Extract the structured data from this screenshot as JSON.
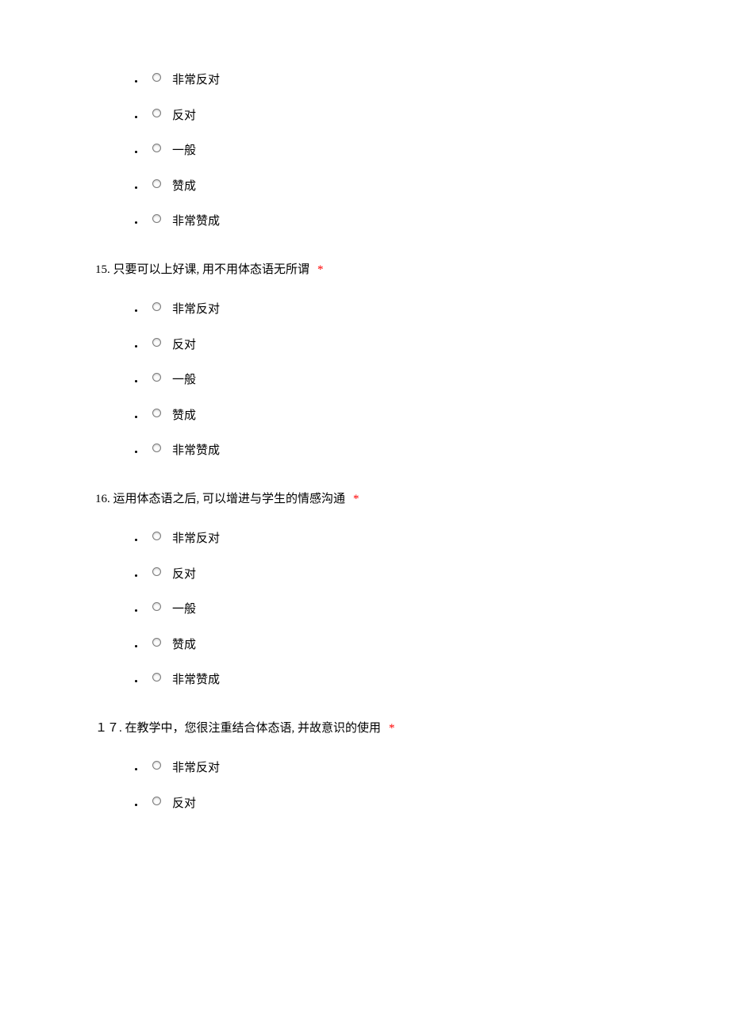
{
  "required_mark": "*",
  "questions": [
    {
      "title": "",
      "has_number": false,
      "options": [
        "非常反对",
        "反对",
        "一般",
        "赞成",
        "非常赞成"
      ]
    },
    {
      "title": "15. 只要可以上好课, 用不用体态语无所谓",
      "has_number": true,
      "options": [
        "非常反对",
        "反对",
        "一般",
        "赞成",
        "非常赞成"
      ]
    },
    {
      "title": "16. 运用体态语之后, 可以增进与学生的情感沟通",
      "has_number": true,
      "options": [
        "非常反对",
        "反对",
        "一般",
        "赞成",
        "非常赞成"
      ]
    },
    {
      "title": "１７. 在教学中，您很注重结合体态语, 并故意识的使用",
      "has_number": true,
      "options": [
        "非常反对",
        "反对"
      ]
    }
  ]
}
